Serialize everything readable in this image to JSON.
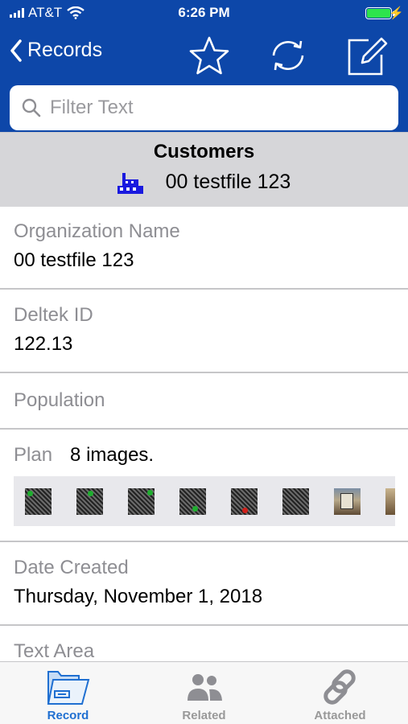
{
  "status_bar": {
    "carrier": "AT&T",
    "time": "6:26 PM",
    "battery_level": 1.0,
    "colors": {
      "battery": "#2ee44c"
    }
  },
  "nav": {
    "back_label": "Records",
    "icons": [
      "star-icon",
      "refresh-icon",
      "edit-icon"
    ],
    "colors": {
      "bar": "#0d47a9"
    }
  },
  "search": {
    "placeholder": "Filter Text",
    "value": ""
  },
  "header": {
    "title": "Customers",
    "record_name": "00 testfile 123",
    "record_icon": "building-icon",
    "colors": {
      "band": "#d6d6d9",
      "icon": "#1a1adf"
    }
  },
  "fields": [
    {
      "label": "Organization Name",
      "value": "00 testfile 123"
    },
    {
      "label": "Deltek ID",
      "value": "122.13"
    },
    {
      "label": "Population",
      "value": ""
    },
    {
      "label": "Plan",
      "value": "8 images."
    },
    {
      "label": "Date Created",
      "value": "Thursday, November 1, 2018"
    },
    {
      "label": "Text Area",
      "value": ""
    }
  ],
  "plan_images": [
    {
      "kind": "pattern",
      "marker": "green"
    },
    {
      "kind": "pattern",
      "marker": "green"
    },
    {
      "kind": "pattern",
      "marker": "green"
    },
    {
      "kind": "pattern",
      "marker": "green"
    },
    {
      "kind": "pattern",
      "marker": "red"
    },
    {
      "kind": "pattern",
      "marker": "none"
    },
    {
      "kind": "photo",
      "marker": "none"
    },
    {
      "kind": "photo",
      "marker": "none"
    }
  ],
  "marker_colors": {
    "green": "#1fae2f",
    "red": "#d0201a"
  },
  "tabs": [
    {
      "label": "Record",
      "icon": "folder-icon",
      "active": true
    },
    {
      "label": "Related",
      "icon": "people-icon",
      "active": false
    },
    {
      "label": "Attached",
      "icon": "link-icon",
      "active": false
    }
  ],
  "tab_colors": {
    "active": "#1f6fd1",
    "inactive": "#999999"
  }
}
